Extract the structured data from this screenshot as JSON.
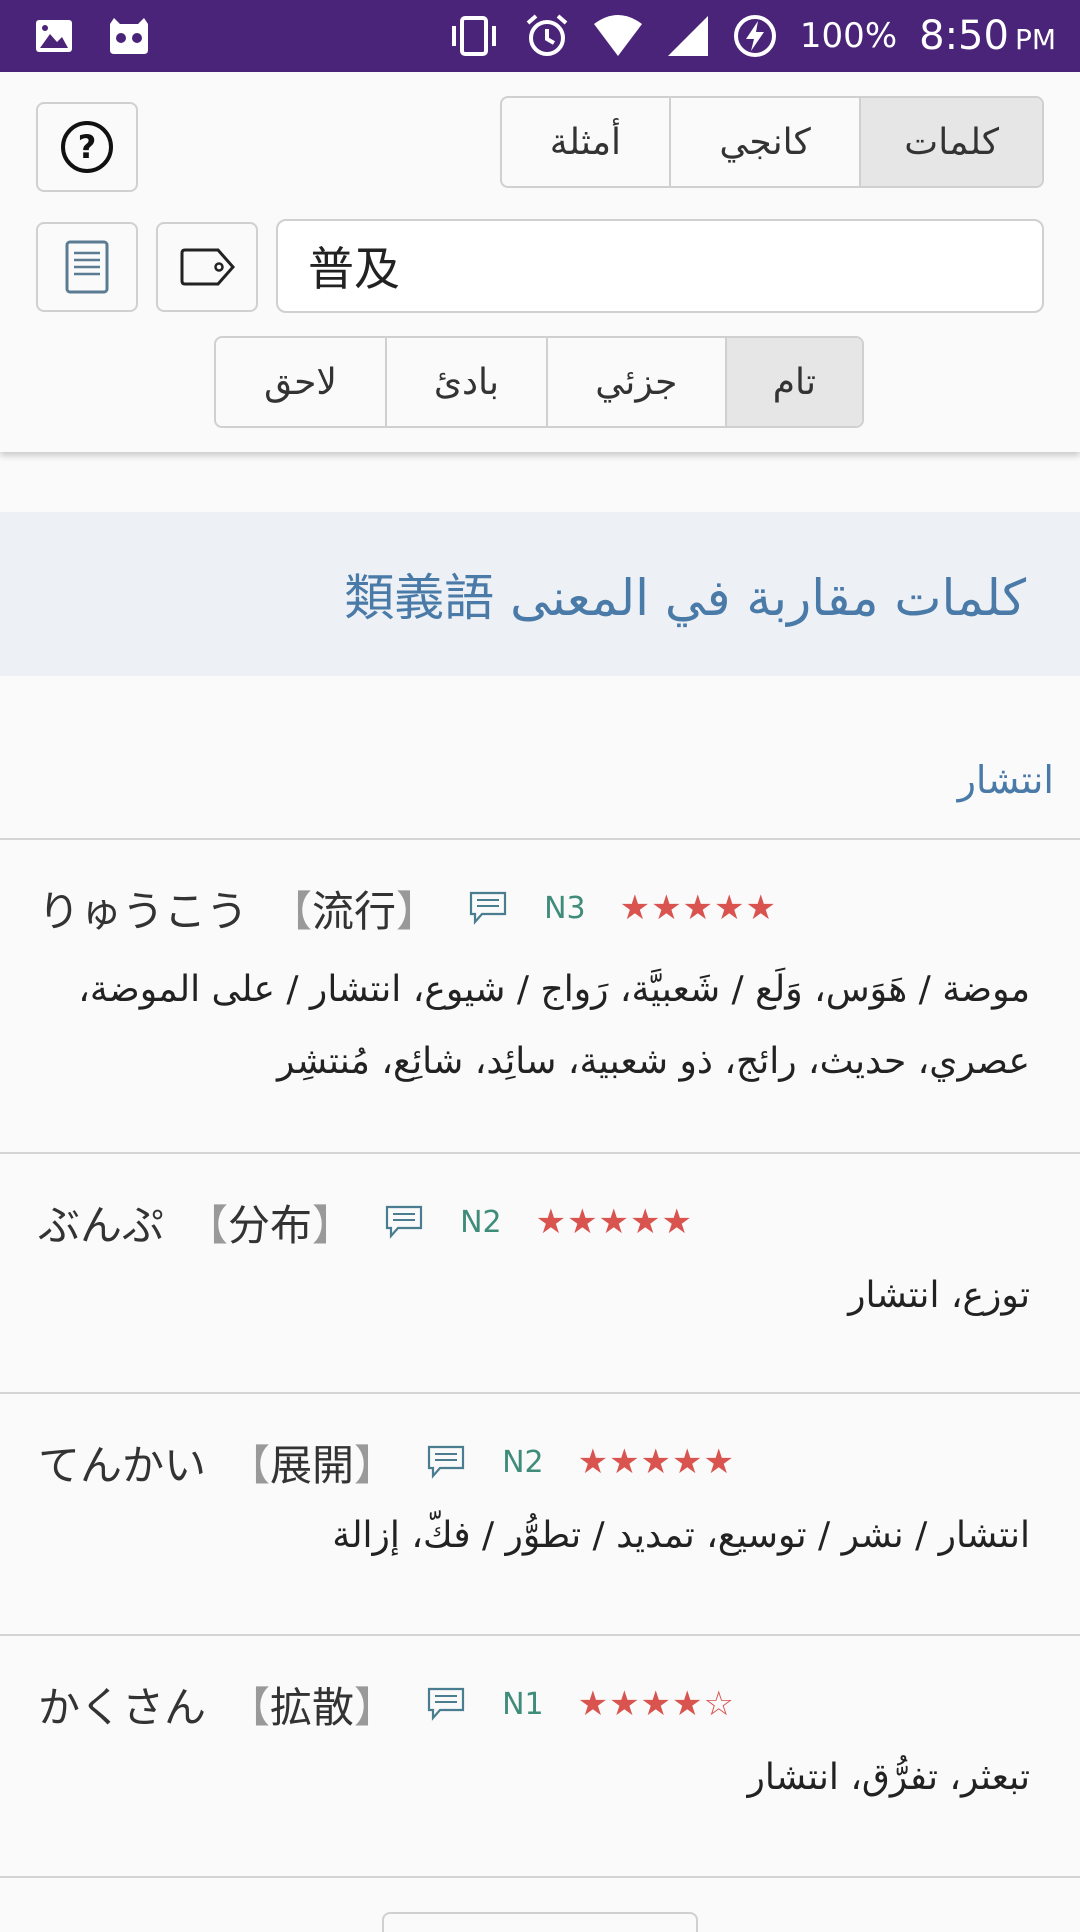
{
  "statusbar": {
    "battery": "100%",
    "time": "8:50",
    "ampm": "PM"
  },
  "header": {
    "tabs": [
      "كلمات",
      "كانجي",
      "أمثلة"
    ],
    "search_value": "普及",
    "match_modes": [
      "تام",
      "جزئي",
      "بادئ",
      "لاحق"
    ]
  },
  "section": {
    "title": "كلمات مقاربة في المعنى 類義語",
    "group_label": "انتشار"
  },
  "entries": [
    {
      "kana": "りゅうこう",
      "kanji": "流行",
      "level": "N3",
      "stars": "★★★★★",
      "meaning": "موضة / هَوَس، وَلَع / شَعبيَّة، رَواج / شيوع، انتشار / على الموضة، عصري، حديث، رائج، ذو شعبية، سائِد، شائِع، مُنتشِر"
    },
    {
      "kana": "ぶんぷ",
      "kanji": "分布",
      "level": "N2",
      "stars": "★★★★★",
      "meaning": "توزع، انتشار"
    },
    {
      "kana": "てんかい",
      "kanji": "展開",
      "level": "N2",
      "stars": "★★★★★",
      "meaning": "انتشار / نشر / توسيع، تمديد / تطوُّر / فكّ، إزالة"
    },
    {
      "kana": "かくさん",
      "kanji": "拡散",
      "level": "N1",
      "stars": "★★★★☆",
      "meaning": "تبعثر، تفرُّق، انتشار"
    }
  ]
}
